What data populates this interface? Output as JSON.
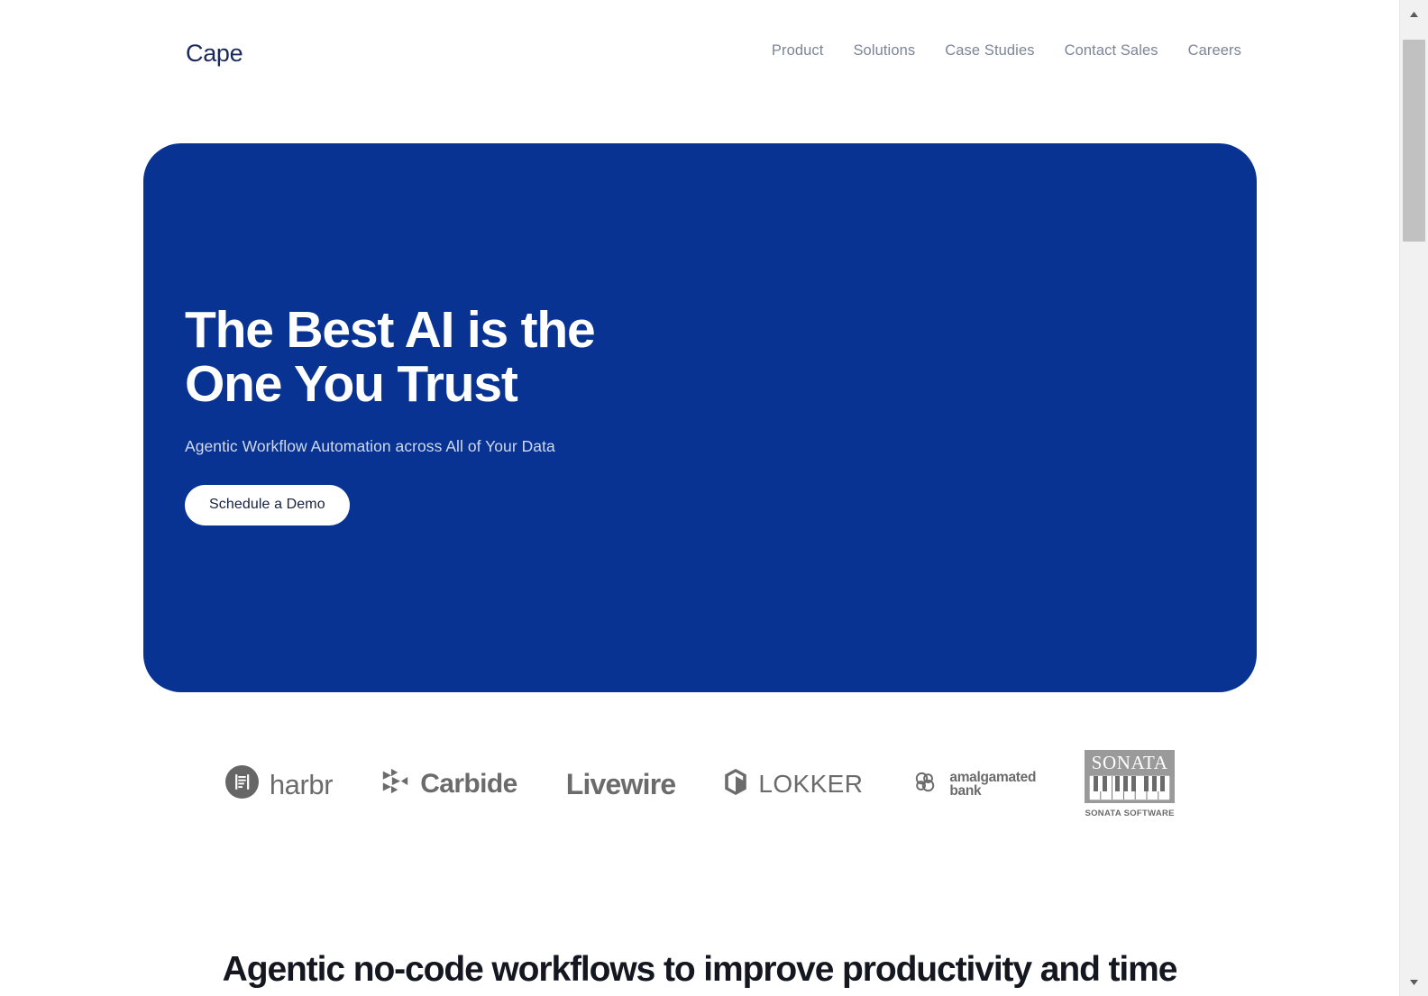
{
  "header": {
    "brand": {
      "name": "Cape",
      "mark_icon": "cape-radial-burst-icon",
      "mark_gradient_from": "#d6429b",
      "mark_gradient_to": "#2f5fd0",
      "name_color": "#1b2a5b"
    },
    "nav": [
      {
        "label": "Product",
        "name": "nav-link-product"
      },
      {
        "label": "Solutions",
        "name": "nav-link-solutions"
      },
      {
        "label": "Case Studies",
        "name": "nav-link-case-studies"
      },
      {
        "label": "Contact Sales",
        "name": "nav-link-contact-sales"
      },
      {
        "label": "Careers",
        "name": "nav-link-careers"
      }
    ],
    "nav_color": "#7c8598"
  },
  "hero": {
    "background_color": "#083393",
    "title": "The Best AI is the\nOne You Trust",
    "subtitle": "Agentic Workflow Automation across All of Your Data",
    "cta_label": "Schedule a Demo",
    "cta_background": "#ffffff",
    "cta_text_color": "#16213f"
  },
  "logos": {
    "items": [
      {
        "name": "logo-harbr",
        "text": "harbr",
        "icon": "harbr-circle-icon"
      },
      {
        "name": "logo-carbide",
        "text": "Carbide",
        "icon": "carbide-triangles-icon"
      },
      {
        "name": "logo-livewire",
        "text": "Livewire",
        "icon": ""
      },
      {
        "name": "logo-lokker",
        "text": "LOKKER",
        "icon": "lokker-hex-icon"
      },
      {
        "name": "logo-amalgamated-bank",
        "text_line1": "amalgamated",
        "text_line2": "bank",
        "icon": "amalgamated-rings-icon"
      },
      {
        "name": "logo-sonata-software",
        "text": "SONATA",
        "caption": "SONATA SOFTWARE",
        "icon": "sonata-piano-keys-icon",
        "box_color": "#9a9a9a"
      }
    ]
  },
  "section": {
    "heading": "Agentic no-code workflows to improve productivity and time"
  },
  "scrollbar": {
    "up_icon": "scroll-up-arrow-icon",
    "down_icon": "scroll-down-arrow-icon",
    "thumb_color": "#c1c1c1",
    "track_color": "#f1f1f1"
  }
}
